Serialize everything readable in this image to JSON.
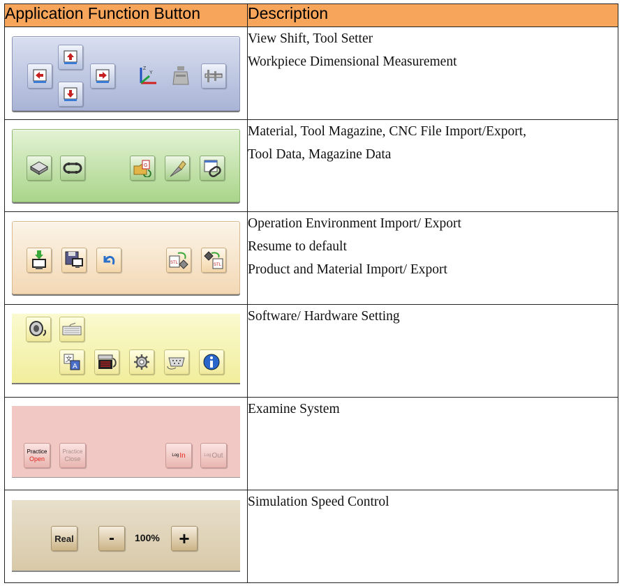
{
  "header": {
    "col1": "Application Function Button",
    "col2": "Description"
  },
  "rows": [
    {
      "description": [
        "View Shift, Tool Setter",
        "Workpiece Dimensional Measurement"
      ]
    },
    {
      "description": [
        "Material, Tool Magazine, CNC File Import/Export,",
        "Tool Data, Magazine Data"
      ]
    },
    {
      "description": [
        "Operation Environment Import/ Export",
        "Resume to default",
        "Product and Material Import/ Export"
      ]
    },
    {
      "description": [
        "Software/ Hardware Setting"
      ]
    },
    {
      "description": [
        "Examine System"
      ]
    },
    {
      "description": [
        "Simulation Speed Control"
      ]
    }
  ],
  "examine_buttons": {
    "practice_open": [
      "Practice",
      "Open"
    ],
    "practice_close": [
      "Practice",
      "Close"
    ],
    "log_in": [
      "Log",
      "In"
    ],
    "log_out": [
      "Log",
      "Out"
    ]
  },
  "speed_control": {
    "real_label": "Real",
    "minus_label": "-",
    "value": "100%",
    "plus_label": "+"
  },
  "colors": {
    "header_bg": "#f7a55a",
    "panel_view": "#b3bedd",
    "panel_material": "#b7dc9c",
    "panel_environment": "#f5dfc2",
    "panel_settings": "#f5f2b0",
    "panel_examine": "#f2c8c4",
    "panel_speed": "#ddd0b2"
  }
}
